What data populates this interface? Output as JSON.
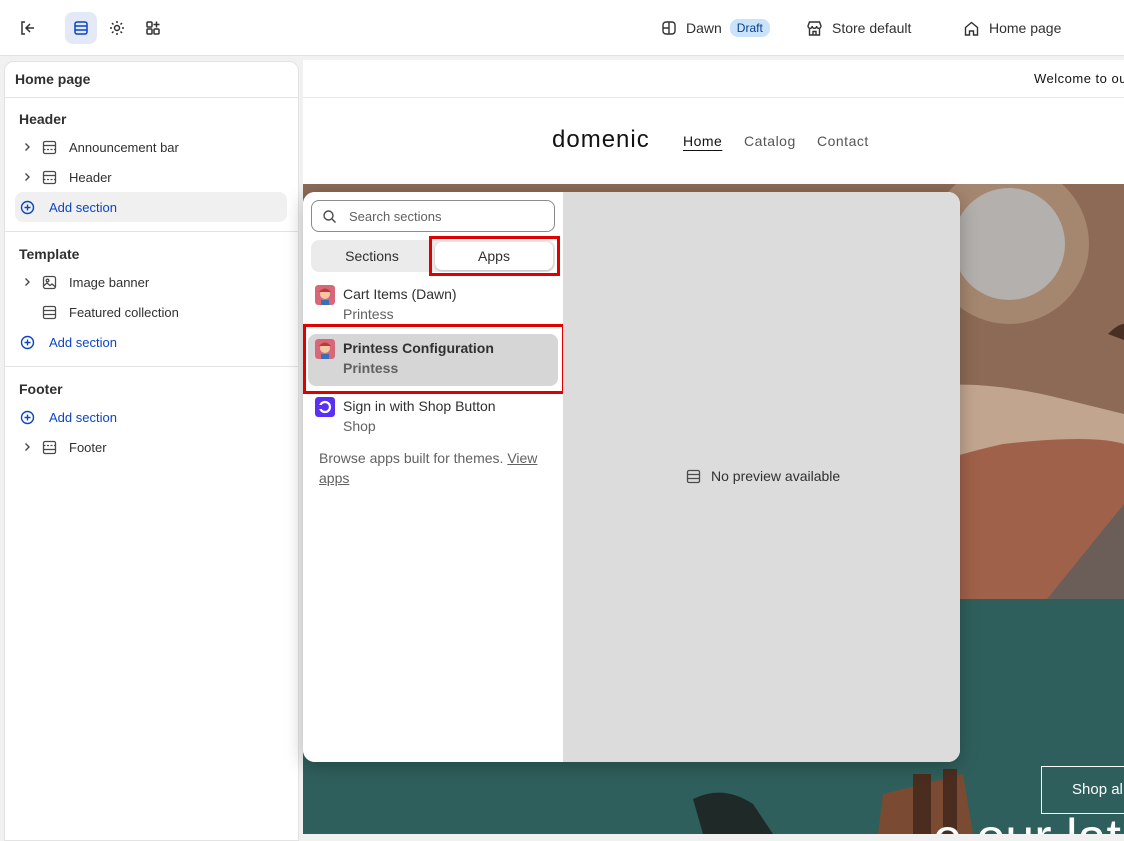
{
  "topbar": {
    "theme_name": "Dawn",
    "theme_status": "Draft",
    "store": "Store default",
    "page": "Home page"
  },
  "sidebar": {
    "title": "Home page",
    "groups": {
      "header": {
        "title": "Header",
        "items": [
          "Announcement bar",
          "Header"
        ],
        "add_label": "Add section"
      },
      "template": {
        "title": "Template",
        "items": [
          "Image banner",
          "Featured collection"
        ],
        "add_label": "Add section"
      },
      "footer": {
        "title": "Footer",
        "add_label": "Add section",
        "items": [
          "Footer"
        ]
      }
    }
  },
  "store_preview": {
    "announcement": "Welcome to ou",
    "logo": "domenic",
    "nav": [
      "Home",
      "Catalog",
      "Contact"
    ],
    "hero_text": "e our lat",
    "hero_button": "Shop al"
  },
  "picker": {
    "search_placeholder": "Search sections",
    "tabs": [
      "Sections",
      "Apps"
    ],
    "apps": [
      {
        "name": "Cart Items (Dawn)",
        "vendor": "Printess"
      },
      {
        "name": "Printess Configuration",
        "vendor": "Printess"
      },
      {
        "name": "Sign in with Shop Button",
        "vendor": "Shop"
      }
    ],
    "browse_text": "Browse apps built for themes. ",
    "browse_link": "View apps",
    "no_preview": "No preview available"
  },
  "colors": {
    "accent": "#0b45c4",
    "highlight_box": "#e00000"
  }
}
